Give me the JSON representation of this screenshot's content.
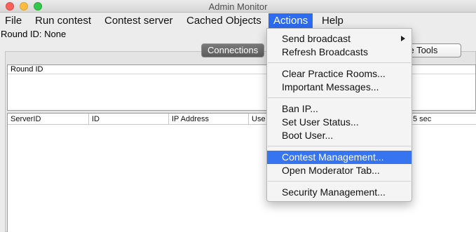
{
  "window": {
    "title": "Admin Monitor"
  },
  "menubar": {
    "items": [
      {
        "label": "File"
      },
      {
        "label": "Run contest"
      },
      {
        "label": "Contest server"
      },
      {
        "label": "Cached Objects"
      },
      {
        "label": "Actions"
      },
      {
        "label": "Help"
      }
    ]
  },
  "round": {
    "label": "Round ID: None"
  },
  "tabs": {
    "connections": "Connections",
    "queue_tools": "eue Tools"
  },
  "round_table": {
    "header": "Round ID"
  },
  "conn_table": {
    "headers": [
      "ServerID",
      "ID",
      "IP Address",
      "Use",
      "5 sec"
    ]
  },
  "actions_menu": {
    "items": [
      {
        "label": "Send broadcast",
        "submenu": true
      },
      {
        "label": "Refresh Broadcasts"
      },
      {
        "label": "Clear Practice Rooms..."
      },
      {
        "label": "Important Messages..."
      },
      {
        "label": "Ban IP..."
      },
      {
        "label": "Set User Status..."
      },
      {
        "label": "Boot User..."
      },
      {
        "label": "Contest Management...",
        "selected": true
      },
      {
        "label": "Open Moderator Tab..."
      },
      {
        "label": "Security Management..."
      }
    ]
  },
  "colors": {
    "accent": "#3774f0",
    "menu_active": "#2d6bf0"
  }
}
